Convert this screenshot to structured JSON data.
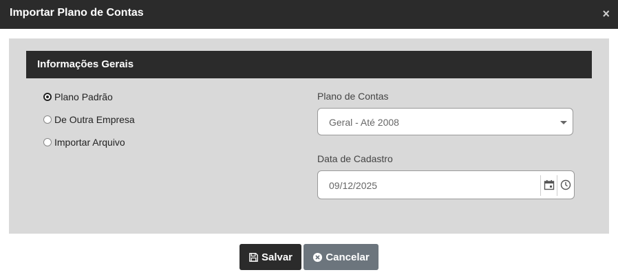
{
  "dialog": {
    "title": "Importar Plano de Contas",
    "close_icon": "×"
  },
  "section": {
    "title": "Informações Gerais"
  },
  "options": [
    {
      "label": "Plano Padrão",
      "checked": true
    },
    {
      "label": "De Outra Empresa",
      "checked": false
    },
    {
      "label": "Importar Arquivo",
      "checked": false
    }
  ],
  "plano": {
    "label": "Plano de Contas",
    "value": "Geral - Até 2008"
  },
  "data_cadastro": {
    "label": "Data de Cadastro",
    "value": "09/12/2025"
  },
  "buttons": {
    "save": "Salvar",
    "cancel": "Cancelar"
  }
}
